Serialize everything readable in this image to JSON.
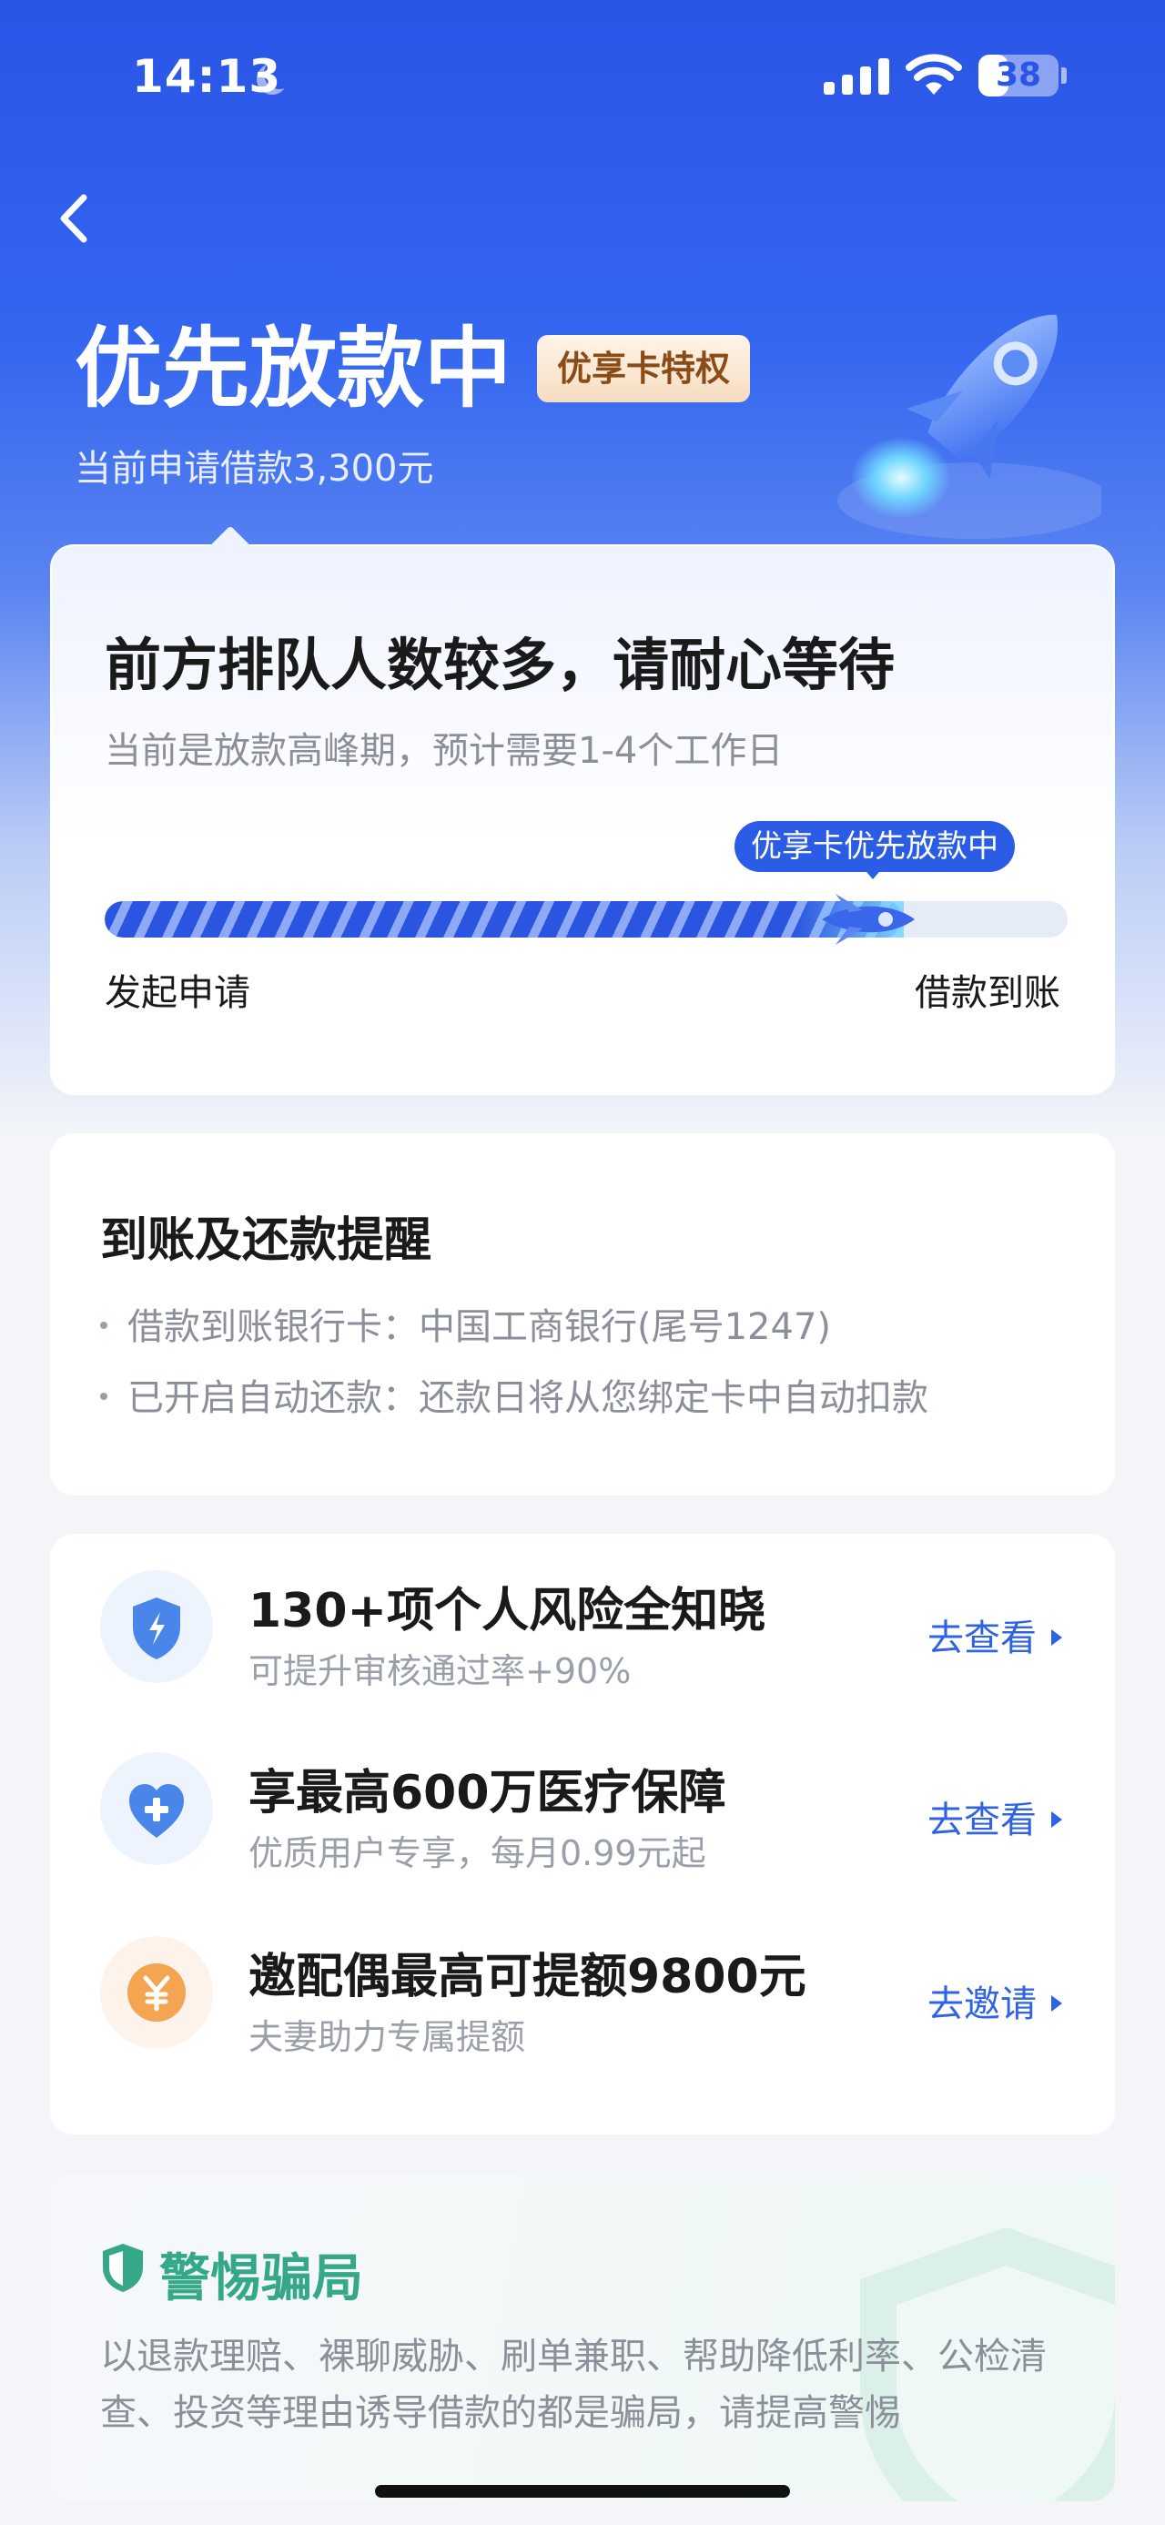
{
  "status_bar": {
    "time": "14:13",
    "battery": "38",
    "battery_level": 0.38
  },
  "header": {
    "title": "优先放款中",
    "badge": "优享卡特权",
    "subtitle": "当前申请借款3,300元"
  },
  "progress": {
    "heading": "前方排队人数较多，请耐心等待",
    "subheading": "当前是放款高峰期，预计需要1-4个工作日",
    "tag": "优享卡优先放款中",
    "value": 0.83,
    "start_label": "发起申请",
    "end_label": "借款到账"
  },
  "reminder": {
    "title": "到账及还款提醒",
    "lines": [
      "借款到账银行卡：中国工商银行(尾号1247)",
      "已开启自动还款：还款日将从您绑定卡中自动扣款"
    ]
  },
  "services": [
    {
      "icon": "shield-lightning-icon",
      "title": "130+项个人风险全知晓",
      "subtitle": "可提升审核通过率+90%",
      "action": "去查看",
      "color": "#4a86ea"
    },
    {
      "icon": "heart-plus-icon",
      "title": "享最高600万医疗保障",
      "subtitle": "优质用户专享，每月0.99元起",
      "action": "去查看",
      "color": "#4a86ea"
    },
    {
      "icon": "yen-coin-icon",
      "title": "邀配偶最高可提额9800元",
      "subtitle": "夫妻助力专属提额",
      "action": "去邀请",
      "color": "#f4a552"
    }
  ],
  "warning": {
    "title": "警惕骗局",
    "text": "以退款理赔、裸聊威胁、刷单兼职、帮助降低利率、公检清查、投资等理由诱导借款的都是骗局，请提高警惕",
    "color": "#35a88a"
  }
}
